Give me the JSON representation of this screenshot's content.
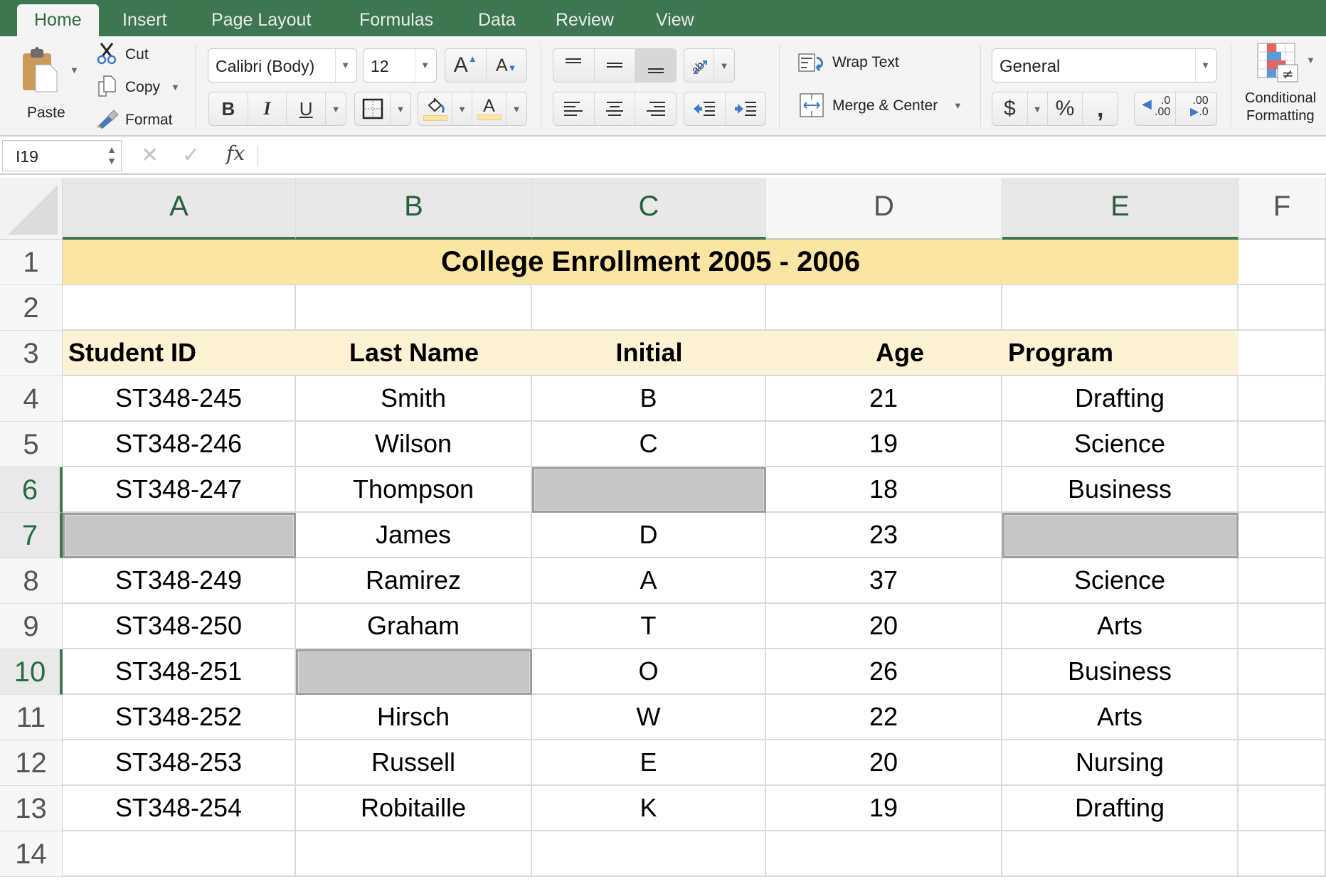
{
  "tabs": [
    {
      "label": "Home",
      "active": true
    },
    {
      "label": "Insert",
      "active": false
    },
    {
      "label": "Page Layout",
      "active": false
    },
    {
      "label": "Formulas",
      "active": false
    },
    {
      "label": "Data",
      "active": false
    },
    {
      "label": "Review",
      "active": false
    },
    {
      "label": "View",
      "active": false
    }
  ],
  "ribbon": {
    "clipboard": {
      "paste_label": "Paste",
      "cut_label": "Cut",
      "copy_label": "Copy",
      "format_label": "Format"
    },
    "font": {
      "font_name": "Calibri (Body)",
      "font_size": "12",
      "bold": "B",
      "italic": "I",
      "underline": "U",
      "grow": "A",
      "shrink": "A",
      "font_color_glyph": "A",
      "fill_color": "#fbe5a2",
      "font_color": "#fbe5a2"
    },
    "alignment": {
      "wrap_text_label": "Wrap Text",
      "merge_center_label": "Merge & Center"
    },
    "number": {
      "format": "General",
      "currency": "$",
      "percent": "%",
      "comma": ",",
      "inc_decimal_top": ".0",
      "inc_decimal_bottom": ".00",
      "dec_decimal_top": ".00",
      "dec_decimal_bottom": ".0"
    },
    "styles": {
      "conditional_formatting_label_1": "Conditional",
      "conditional_formatting_label_2": "Formatting"
    }
  },
  "formula_bar": {
    "name_box": "I19",
    "cancel_glyph": "✕",
    "enter_glyph": "✓",
    "fx_label": "fx",
    "content": ""
  },
  "colors": {
    "accent": "#3d7650",
    "title_fill": "#fbe5a2",
    "header_fill": "#fdf2d3",
    "blank_fill": "#c6c6c6"
  },
  "sheet": {
    "columns": [
      "A",
      "B",
      "C",
      "D",
      "E",
      "F"
    ],
    "selected_columns": [
      "A",
      "B",
      "C",
      "E"
    ],
    "row_numbers": [
      "1",
      "2",
      "3",
      "4",
      "5",
      "6",
      "7",
      "8",
      "9",
      "10",
      "11",
      "12",
      "13",
      "14"
    ],
    "selected_rows": [
      "6",
      "7",
      "10"
    ],
    "title": "College Enrollment 2005 - 2006",
    "headers": [
      "Student ID",
      "Last Name",
      "Initial",
      "Age",
      "Program"
    ],
    "rows": [
      [
        "ST348-245",
        "Smith",
        "B",
        "21",
        "Drafting"
      ],
      [
        "ST348-246",
        "Wilson",
        "C",
        "19",
        "Science"
      ],
      [
        "ST348-247",
        "Thompson",
        "",
        "18",
        "Business"
      ],
      [
        "",
        "James",
        "D",
        "23",
        ""
      ],
      [
        "ST348-249",
        "Ramirez",
        "A",
        "37",
        "Science"
      ],
      [
        "ST348-250",
        "Graham",
        "T",
        "20",
        "Arts"
      ],
      [
        "ST348-251",
        "",
        "O",
        "26",
        "Business"
      ],
      [
        "ST348-252",
        "Hirsch",
        "W",
        "22",
        "Arts"
      ],
      [
        "ST348-253",
        "Russell",
        "E",
        "20",
        "Nursing"
      ],
      [
        "ST348-254",
        "Robitaille",
        "K",
        "19",
        "Drafting"
      ]
    ],
    "blank_highlighted_cells": [
      "C6",
      "A7",
      "E7",
      "B10"
    ]
  }
}
